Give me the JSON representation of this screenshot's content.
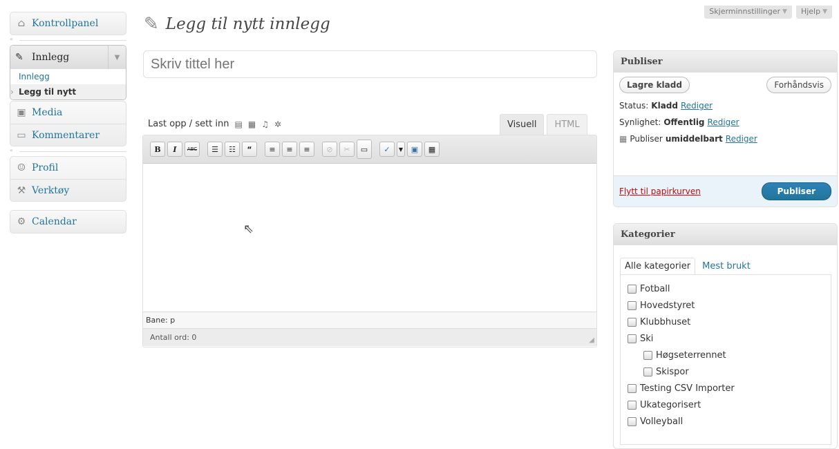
{
  "screen_meta": {
    "options": "Skjerminnstillinger",
    "help": "Hjelp"
  },
  "menu": {
    "dashboard": "Kontrollpanel",
    "posts": {
      "label": "Innlegg",
      "submenu": [
        "Innlegg",
        "Legg til nytt"
      ]
    },
    "media": "Media",
    "comments": "Kommentarer",
    "profile": "Profil",
    "tools": "Verktøy",
    "calendar": "Calendar"
  },
  "page": {
    "title": "Legg til nytt innlegg"
  },
  "title_field": {
    "placeholder": "Skriv tittel her"
  },
  "editor": {
    "upload_label": "Last opp / sett inn",
    "tab_visual": "Visuell",
    "tab_html": "HTML",
    "path_label": "Bane: p",
    "word_count": "Antall ord: 0"
  },
  "publish": {
    "heading": "Publiser",
    "save_draft": "Lagre kladd",
    "preview": "Forhåndsvis",
    "status_label": "Status:",
    "status_value": "Kladd",
    "visibility_label": "Synlighet:",
    "visibility_value": "Offentlig",
    "schedule_label": "Publiser",
    "schedule_value": "umiddelbart",
    "edit_link": "Rediger",
    "trash": "Flytt til papirkurven",
    "publish_button": "Publiser"
  },
  "categories": {
    "heading": "Kategorier",
    "tab_all": "Alle kategorier",
    "tab_popular": "Mest brukt",
    "items": [
      {
        "label": "Fotball",
        "child": false
      },
      {
        "label": "Hovedstyret",
        "child": false
      },
      {
        "label": "Klubbhuset",
        "child": false
      },
      {
        "label": "Ski",
        "child": false
      },
      {
        "label": "Høgseterrennet",
        "child": true
      },
      {
        "label": "Skispor",
        "child": true
      },
      {
        "label": "Testing CSV Importer",
        "child": false
      },
      {
        "label": "Ukategorisert",
        "child": false
      },
      {
        "label": "Volleyball",
        "child": false
      }
    ]
  }
}
